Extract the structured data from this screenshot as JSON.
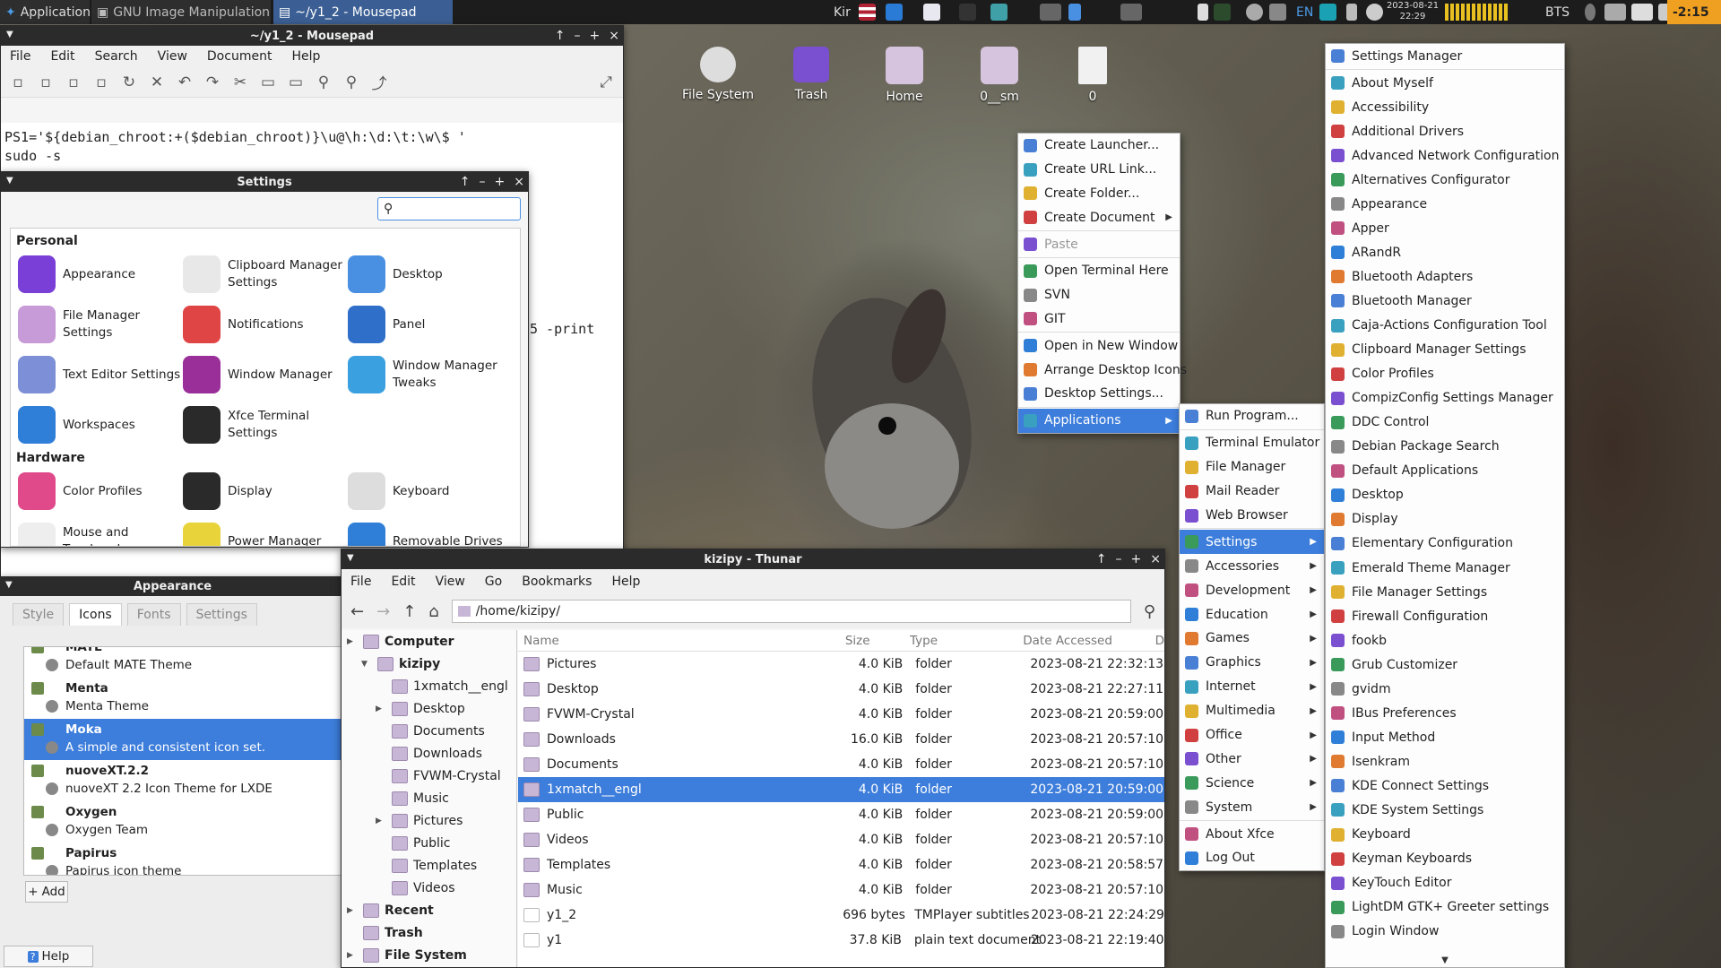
{
  "topbar": {
    "apps_label": "Applications",
    "tasks": [
      "GNU Image Manipulation ...",
      "~/y1_2 - Mousepad"
    ],
    "kbd": "Kir",
    "lang": "EN",
    "date": "2023-08-21",
    "time": "22:29",
    "tz": "BTS",
    "battery": "-2:15"
  },
  "desktop": {
    "icons": [
      "File System",
      "Trash",
      "Home",
      "0__sm",
      "0"
    ]
  },
  "mousepad": {
    "title": "~/y1_2 - Mousepad",
    "menu": [
      "File",
      "Edit",
      "Search",
      "View",
      "Document",
      "Help"
    ],
    "lines": [
      "PS1='${debian_chroot:+($debian_chroot)}\\u@\\h:\\d:\\t:\\w\\$ '",
      "sudo -s"
    ],
    "fragment": "5 -print"
  },
  "settings": {
    "title": "Settings",
    "search_placeholder": "",
    "personal_label": "Personal",
    "hardware_label": "Hardware",
    "personal": [
      {
        "label": "Appearance",
        "color": "#7a3fd6"
      },
      {
        "label": "Clipboard Manager Settings",
        "color": "#e8e8e8"
      },
      {
        "label": "Desktop",
        "color": "#4a90e2"
      },
      {
        "label": "File Manager Settings",
        "color": "#c79ad8"
      },
      {
        "label": "Notifications",
        "color": "#e04545"
      },
      {
        "label": "Panel",
        "color": "#2f6fc9"
      },
      {
        "label": "Text Editor Settings",
        "color": "#7d8fd6"
      },
      {
        "label": "Window Manager",
        "color": "#9a2f9a"
      },
      {
        "label": "Window Manager Tweaks",
        "color": "#3aa0e0"
      },
      {
        "label": "Workspaces",
        "color": "#2f7fd8"
      },
      {
        "label": "Xfce Terminal Settings",
        "color": "#2a2a2a"
      }
    ],
    "hardware": [
      {
        "label": "Color Profiles",
        "color": "#e04a8a"
      },
      {
        "label": "Display",
        "color": "#2a2a2a"
      },
      {
        "label": "Keyboard",
        "color": "#dddddd"
      },
      {
        "label": "Mouse and Touchpad",
        "color": "#eeeeee"
      },
      {
        "label": "Power Manager",
        "color": "#e8d43a"
      },
      {
        "label": "Removable Drives",
        "color": "#2f7fd8"
      }
    ]
  },
  "appearance": {
    "title": "Appearance",
    "tabs": [
      "Style",
      "Icons",
      "Fonts",
      "Settings"
    ],
    "themes": [
      {
        "name": "MATE",
        "desc": "Default MATE Theme"
      },
      {
        "name": "Menta",
        "desc": "Menta Theme"
      },
      {
        "name": "Moka",
        "desc": "A simple and consistent icon set."
      },
      {
        "name": "nuoveXT.2.2",
        "desc": "nuoveXT 2.2 Icon Theme for LXDE"
      },
      {
        "name": "Oxygen",
        "desc": "Oxygen Team"
      },
      {
        "name": "Papirus",
        "desc": "Papirus icon theme"
      }
    ],
    "add_label": "Add",
    "help_label": "Help"
  },
  "thunar": {
    "title": "kizipy - Thunar",
    "menu": [
      "File",
      "Edit",
      "View",
      "Go",
      "Bookmarks",
      "Help"
    ],
    "path": "/home/kizipy/",
    "side": [
      {
        "label": "Computer",
        "lvl": 0,
        "bold": true
      },
      {
        "label": "kizipy",
        "lvl": 1,
        "bold": true
      },
      {
        "label": "1xmatch__engl",
        "lvl": 2
      },
      {
        "label": "Desktop",
        "lvl": 2
      },
      {
        "label": "Documents",
        "lvl": 2
      },
      {
        "label": "Downloads",
        "lvl": 2
      },
      {
        "label": "FVWM-Crystal",
        "lvl": 2
      },
      {
        "label": "Music",
        "lvl": 2
      },
      {
        "label": "Pictures",
        "lvl": 2
      },
      {
        "label": "Public",
        "lvl": 2
      },
      {
        "label": "Templates",
        "lvl": 2
      },
      {
        "label": "Videos",
        "lvl": 2
      },
      {
        "label": "Recent",
        "lvl": 0,
        "bold": true
      },
      {
        "label": "Trash",
        "lvl": 0,
        "bold": true
      },
      {
        "label": "File System",
        "lvl": 0,
        "bold": true
      }
    ],
    "columns": [
      "Name",
      "Size",
      "Type",
      "Date Accessed",
      "D"
    ],
    "files": [
      [
        "Pictures",
        "4.0 KiB",
        "folder",
        "2023-08-21 22:32:13"
      ],
      [
        "Desktop",
        "4.0 KiB",
        "folder",
        "2023-08-21 22:27:11"
      ],
      [
        "FVWM-Crystal",
        "4.0 KiB",
        "folder",
        "2023-08-21 20:59:00"
      ],
      [
        "Downloads",
        "16.0 KiB",
        "folder",
        "2023-08-21 20:57:10"
      ],
      [
        "Documents",
        "4.0 KiB",
        "folder",
        "2023-08-21 20:57:10"
      ],
      [
        "1xmatch__engl",
        "4.0 KiB",
        "folder",
        "2023-08-21 20:59:00"
      ],
      [
        "Public",
        "4.0 KiB",
        "folder",
        "2023-08-21 20:59:00"
      ],
      [
        "Videos",
        "4.0 KiB",
        "folder",
        "2023-08-21 20:57:10"
      ],
      [
        "Templates",
        "4.0 KiB",
        "folder",
        "2023-08-21 20:58:57"
      ],
      [
        "Music",
        "4.0 KiB",
        "folder",
        "2023-08-21 20:57:10"
      ],
      [
        "y1_2",
        "696 bytes",
        "TMPlayer subtitles",
        "2023-08-21 22:24:29"
      ],
      [
        "y1",
        "37.8 KiB",
        "plain text document",
        "2023-08-21 22:19:40"
      ]
    ]
  },
  "desktop_menu": [
    "Create Launcher...",
    "Create URL Link...",
    "Create Folder...",
    "Create Document",
    "Paste",
    "Open Terminal Here",
    "SVN",
    "GIT",
    "Open in New Window",
    "Arrange Desktop Icons",
    "Desktop Settings...",
    "Applications"
  ],
  "apps_menu": [
    "Run Program...",
    "Terminal Emulator",
    "File Manager",
    "Mail Reader",
    "Web Browser",
    "Settings",
    "Accessories",
    "Development",
    "Education",
    "Games",
    "Graphics",
    "Internet",
    "Multimedia",
    "Office",
    "Other",
    "Science",
    "System",
    "About Xfce",
    "Log Out"
  ],
  "settings_menu": [
    "Settings Manager",
    "About Myself",
    "Accessibility",
    "Additional Drivers",
    "Advanced Network Configuration",
    "Alternatives Configurator",
    "Appearance",
    "Apper",
    "ARandR",
    "Bluetooth Adapters",
    "Bluetooth Manager",
    "Caja-Actions Configuration Tool",
    "Clipboard Manager Settings",
    "Color Profiles",
    "CompizConfig Settings Manager",
    "DDC Control",
    "Debian Package Search",
    "Default Applications",
    "Desktop",
    "Display",
    "Elementary Configuration",
    "Emerald Theme Manager",
    "File Manager Settings",
    "Firewall Configuration",
    "fookb",
    "Grub Customizer",
    "gvidm",
    "IBus Preferences",
    "Input Method",
    "Isenkram",
    "KDE Connect Settings",
    "KDE System Settings",
    "Keyboard",
    "Keyman Keyboards",
    "KeyTouch Editor",
    "LightDM GTK+ Greeter settings",
    "Login Window"
  ]
}
